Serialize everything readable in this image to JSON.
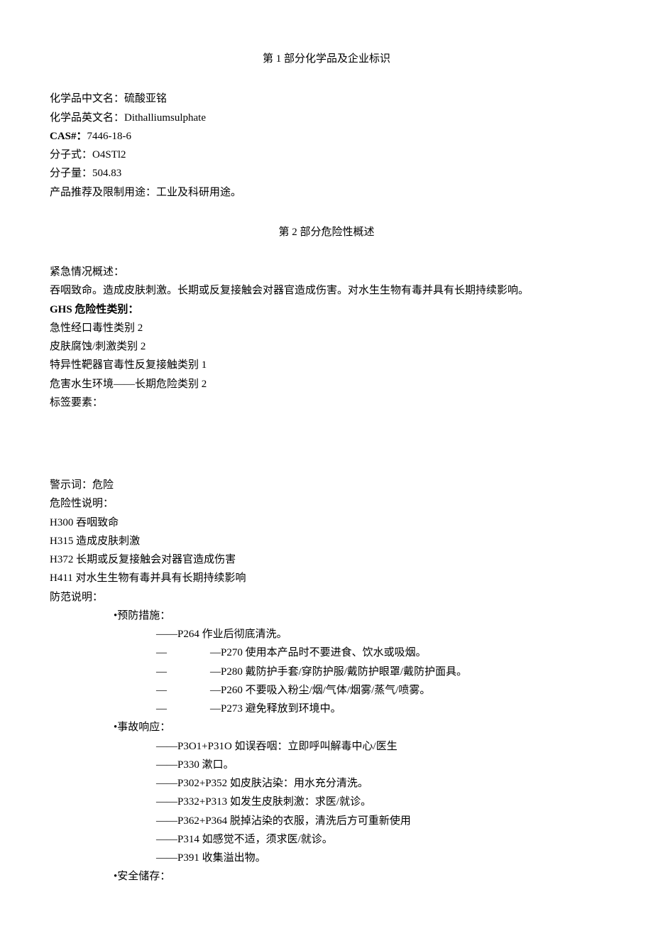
{
  "section1": {
    "title": "第 1 部分化学品及企业标识",
    "cn_name_label": "化学品中文名：",
    "cn_name": "硫酸亚铭",
    "en_name_label": "化学品英文名：",
    "en_name": "Dithalliumsulphate",
    "cas_label": "CAS#：",
    "cas": "7446-18-6",
    "formula_label": "分子式：",
    "formula": "O4STl2",
    "mw_label": "分子量：",
    "mw": "504.83",
    "use_label": "产品推荐及限制用途：",
    "use": "工业及科研用途。"
  },
  "section2": {
    "title": "第 2 部分危险性概述",
    "emerg_label": "紧急情况概述：",
    "emerg_text": "吞咽致命。造成皮肤刺激。长期或反复接触会对器官造成伤害。对水生生物有毒并具有长期持续影响。",
    "ghs_label": "GHS 危险性类别：",
    "ghs": [
      "急性经口毒性类别 2",
      "皮肤腐蚀/刺激类别 2",
      "特异性靶器官毒性反复接触类别 1",
      "危害水生环境——长期危险类别 2"
    ],
    "label_elements": "标签要素：",
    "signal_label": "警示词：",
    "signal": "危险",
    "hazard_label": "危险性说明：",
    "hazards": [
      "H300 吞咽致命",
      "H315 造成皮肤刺激",
      "H372 长期或反复接触会对器官造成伤害",
      "H411 对水生生物有毒并具有长期持续影响"
    ],
    "precaution_label": "防范说明：",
    "prevention_label": "•预防措施：",
    "prevention": {
      "p264": "——P264 作业后彻底清洗。",
      "p270": "—P270 使用本产品时不要进食、饮水或吸烟。",
      "p280": "—P280 戴防护手套/穿防护服/戴防护眼罩/戴防护面具。",
      "p260": "—P260 不要吸入粉尘/烟/气体/烟雾/蒸气/喷雾。",
      "p273": "—P273 避免释放到环境中。"
    },
    "response_label": "•事故响应：",
    "response": [
      "——P3O1+P31O 如误吞咽：立即呼叫解毒中心/医生",
      "——P330 漱口。",
      "——P302+P352 如皮肤沾染：用水充分清洗。",
      "——P332+P313 如发生皮肤刺激：求医/就诊。",
      "——P362+P364 脱掉沾染的衣服，清洗后方可重新使用",
      "——P314 如感觉不适，须求医/就诊。",
      "——P391 收集溢出物。"
    ],
    "storage_label": "•安全储存："
  },
  "dash": "—"
}
